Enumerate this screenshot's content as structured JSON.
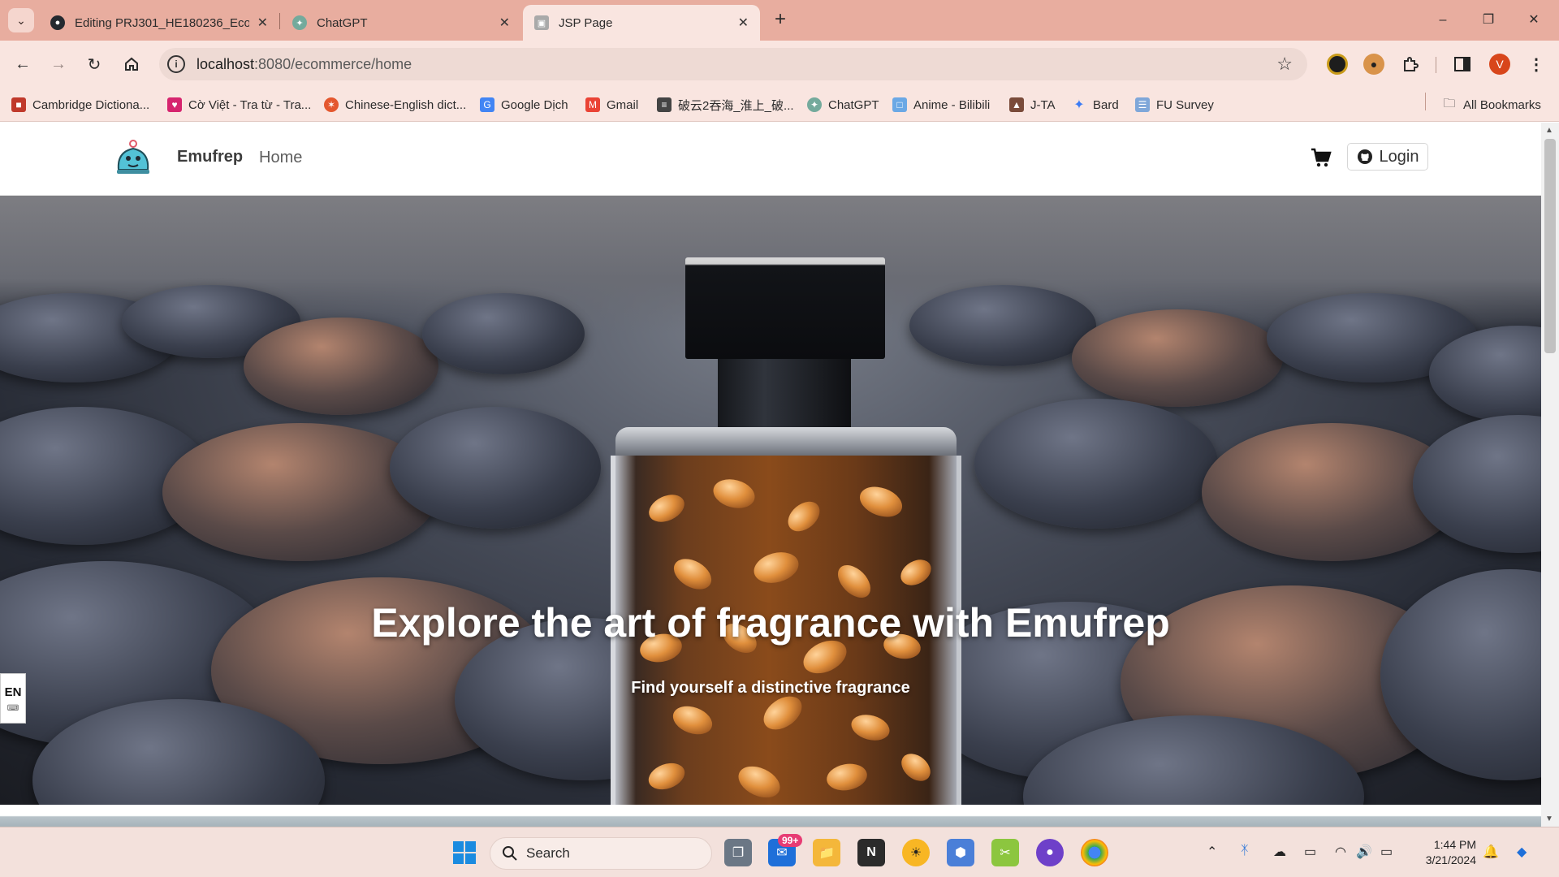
{
  "browser": {
    "tabs": [
      {
        "title": "Editing PRJ301_HE180236_Ecom",
        "active": false,
        "icon": "github-icon"
      },
      {
        "title": "ChatGPT",
        "active": false,
        "icon": "chatgpt-icon"
      },
      {
        "title": "JSP Page",
        "active": true,
        "icon": "page-icon"
      }
    ],
    "url_host": "localhost",
    "url_path": ":8080/ecommerce/home",
    "bookmarks": [
      {
        "label": "Cambridge Dictiona...",
        "icon": "cambridge-icon"
      },
      {
        "label": "Cờ Việt - Tra từ - Tra...",
        "icon": "coviet-icon"
      },
      {
        "label": "Chinese-English dict...",
        "icon": "dict-icon"
      },
      {
        "label": "Google Dịch",
        "icon": "translate-icon"
      },
      {
        "label": "Gmail",
        "icon": "gmail-icon"
      },
      {
        "label": "破云2吞海_淮上_破...",
        "icon": "book-icon"
      },
      {
        "label": "ChatGPT",
        "icon": "chatgpt-icon"
      },
      {
        "label": "Anime - Bilibili",
        "icon": "bilibili-icon"
      },
      {
        "label": "J-TA",
        "icon": "jta-icon"
      },
      {
        "label": "Bard",
        "icon": "bard-icon"
      },
      {
        "label": "FU Survey",
        "icon": "survey-icon"
      }
    ],
    "all_bookmarks": "All Bookmarks",
    "profile_initial": "V"
  },
  "site": {
    "brand": "Emufrep",
    "nav_home": "Home",
    "login": "Login"
  },
  "hero": {
    "title": "Explore the art of fragrance with Emufrep",
    "subtitle": "Find yourself a distinctive fragrance"
  },
  "lang": "EN",
  "taskbar": {
    "search": "Search",
    "mail_badge": "99+",
    "time": "1:44 PM",
    "date": "3/21/2024"
  },
  "colors": {
    "tabstrip": "#e8ad9f",
    "toolbar": "#f9e5e0",
    "taskbar": "#f3e1dc"
  }
}
